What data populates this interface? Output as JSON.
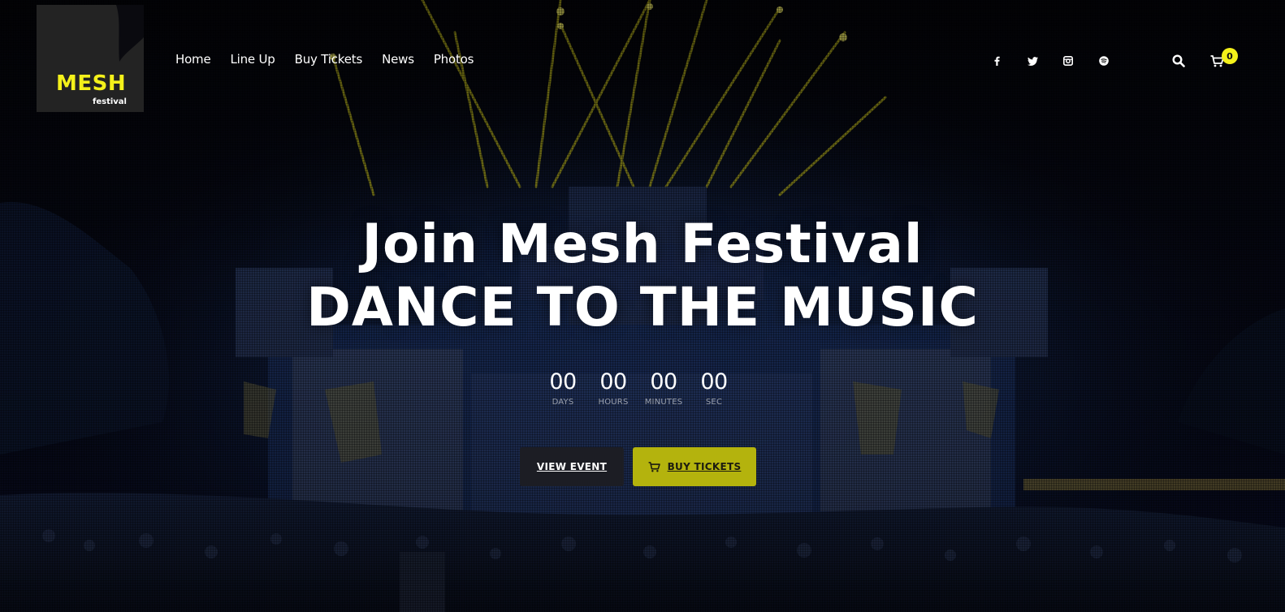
{
  "brand": {
    "name": "MESH",
    "tagline": "festival",
    "accent_color": "#f4f11a"
  },
  "nav": {
    "items": [
      {
        "label": "Home"
      },
      {
        "label": "Line Up"
      },
      {
        "label": "Buy Tickets"
      },
      {
        "label": "News"
      },
      {
        "label": "Photos"
      }
    ]
  },
  "social": [
    "facebook-icon",
    "twitter-icon",
    "instagram-icon",
    "spotify-icon"
  ],
  "tools": {
    "search_icon": "search-icon",
    "cart_icon": "cart-icon",
    "cart_count": "0"
  },
  "hero": {
    "title_line1": "Join Mesh Festival",
    "title_line2": "DANCE TO THE MUSIC",
    "countdown": [
      {
        "value": "00",
        "label": "DAYS"
      },
      {
        "value": "00",
        "label": "HOURS"
      },
      {
        "value": "00",
        "label": "MINUTES"
      },
      {
        "value": "00",
        "label": "SEC"
      }
    ],
    "buttons": {
      "view_event": "VIEW EVENT",
      "buy_tickets": "BUY TICKETS"
    },
    "buy_button_color": "#b4b30d"
  }
}
